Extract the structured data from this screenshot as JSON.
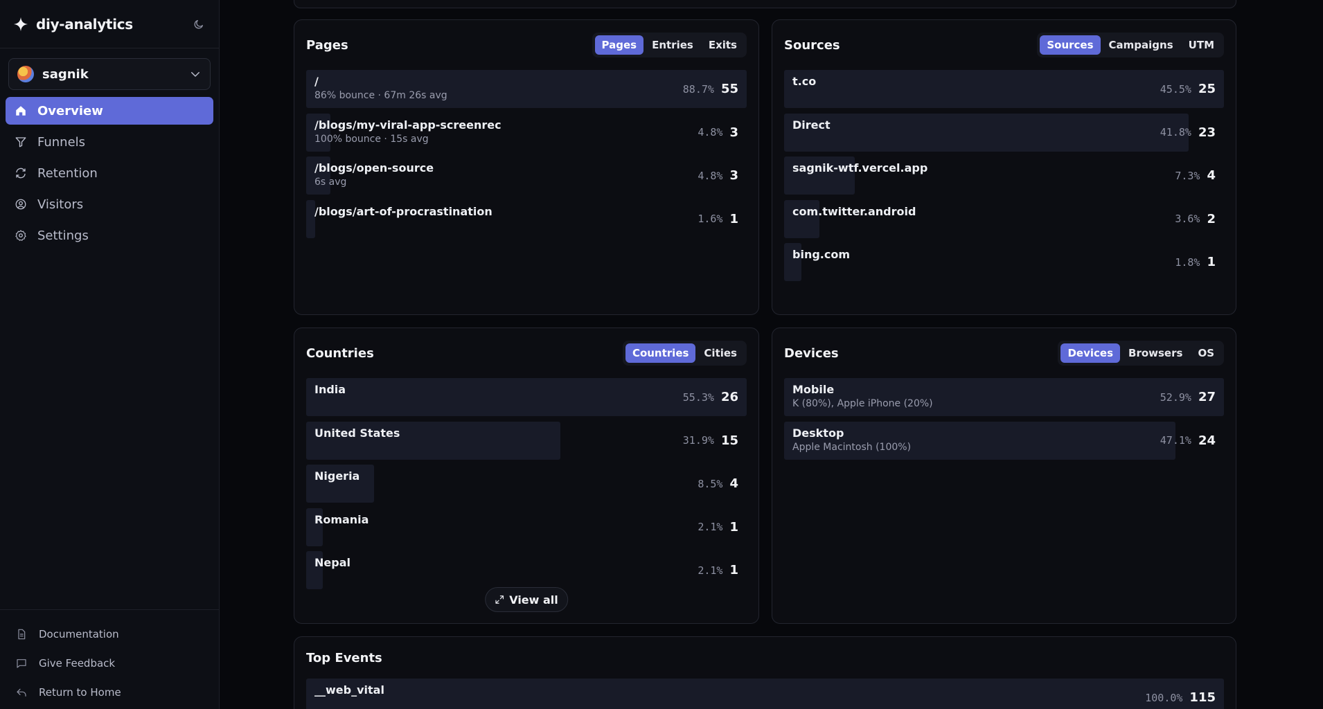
{
  "app": {
    "name": "diy-analytics"
  },
  "workspace": {
    "name": "sagnik"
  },
  "nav": [
    {
      "label": "Overview",
      "icon": "home-icon",
      "active": true
    },
    {
      "label": "Funnels",
      "icon": "funnel-icon"
    },
    {
      "label": "Retention",
      "icon": "refresh-icon"
    },
    {
      "label": "Visitors",
      "icon": "user-circle-icon"
    },
    {
      "label": "Settings",
      "icon": "gear-icon"
    }
  ],
  "footer": [
    {
      "label": "Documentation",
      "icon": "document-icon"
    },
    {
      "label": "Give Feedback",
      "icon": "message-icon"
    },
    {
      "label": "Return to Home",
      "icon": "return-icon"
    }
  ],
  "colors": {
    "accent": "#5f6ad8",
    "bar": "#181b28",
    "background": "#07080c",
    "card": "#0c0d12"
  },
  "pages": {
    "title": "Pages",
    "tabs": [
      "Pages",
      "Entries",
      "Exits"
    ],
    "active_tab": 0,
    "rows": [
      {
        "label": "/",
        "sub": "86% bounce · 67m 26s avg",
        "pct": "88.7%",
        "count": "55",
        "share": 1.0
      },
      {
        "label": "/blogs/my-viral-app-screenrec",
        "sub": "100% bounce · 15s avg",
        "pct": "4.8%",
        "count": "3",
        "share": 0.055
      },
      {
        "label": "/blogs/open-source",
        "sub": "6s avg",
        "pct": "4.8%",
        "count": "3",
        "share": 0.055
      },
      {
        "label": "/blogs/art-of-procrastination",
        "sub": "",
        "pct": "1.6%",
        "count": "1",
        "share": 0.018
      }
    ]
  },
  "sources": {
    "title": "Sources",
    "tabs": [
      "Sources",
      "Campaigns",
      "UTM"
    ],
    "active_tab": 0,
    "rows": [
      {
        "label": "t.co",
        "sub": "",
        "pct": "45.5%",
        "count": "25",
        "share": 1.0
      },
      {
        "label": "Direct",
        "sub": "",
        "pct": "41.8%",
        "count": "23",
        "share": 0.92
      },
      {
        "label": "sagnik-wtf.vercel.app",
        "sub": "",
        "pct": "7.3%",
        "count": "4",
        "share": 0.16
      },
      {
        "label": "com.twitter.android",
        "sub": "",
        "pct": "3.6%",
        "count": "2",
        "share": 0.08
      },
      {
        "label": "bing.com",
        "sub": "",
        "pct": "1.8%",
        "count": "1",
        "share": 0.04
      }
    ]
  },
  "countries": {
    "title": "Countries",
    "tabs": [
      "Countries",
      "Cities"
    ],
    "active_tab": 0,
    "view_all": "View all",
    "rows": [
      {
        "label": "India",
        "sub": "",
        "pct": "55.3%",
        "count": "26",
        "share": 1.0
      },
      {
        "label": "United States",
        "sub": "",
        "pct": "31.9%",
        "count": "15",
        "share": 0.577
      },
      {
        "label": "Nigeria",
        "sub": "",
        "pct": "8.5%",
        "count": "4",
        "share": 0.154
      },
      {
        "label": "Romania",
        "sub": "",
        "pct": "2.1%",
        "count": "1",
        "share": 0.038
      },
      {
        "label": "Nepal",
        "sub": "",
        "pct": "2.1%",
        "count": "1",
        "share": 0.038
      }
    ]
  },
  "devices": {
    "title": "Devices",
    "tabs": [
      "Devices",
      "Browsers",
      "OS"
    ],
    "active_tab": 0,
    "rows": [
      {
        "label": "Mobile",
        "sub": "K (80%), Apple iPhone (20%)",
        "pct": "52.9%",
        "count": "27",
        "share": 1.0
      },
      {
        "label": "Desktop",
        "sub": "Apple Macintosh (100%)",
        "pct": "47.1%",
        "count": "24",
        "share": 0.889
      }
    ]
  },
  "events": {
    "title": "Top Events",
    "rows": [
      {
        "label": "__web_vital",
        "sub": "",
        "pct": "100.0%",
        "count": "115",
        "share": 1.0
      }
    ]
  }
}
